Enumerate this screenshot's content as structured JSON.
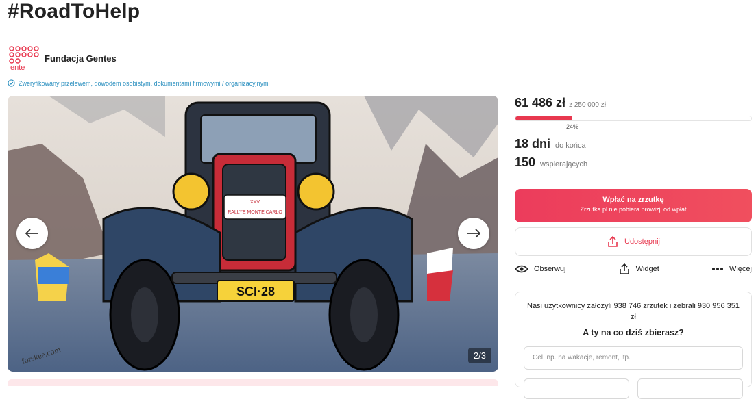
{
  "title": "#RoadToHelp",
  "organizer": {
    "name": "Fundacja Gentes",
    "logo_text": "ente"
  },
  "verification": "Zweryfikowany przelewem, dowodem osobistym, dokumentami firmowymi / organizacyjnymi",
  "gallery": {
    "counter": "2/3",
    "plate_text": "SCI·28",
    "badge_text": "RALLYE MONTE CARLO",
    "badge_top": "XXV",
    "signature": "forskee.com"
  },
  "stats": {
    "raised": "61 486 zł",
    "goal": "z 250 000 zł",
    "progress_percent": 24,
    "progress_label": "24%",
    "days": "18 dni",
    "days_label": "do końca",
    "supporters": "150",
    "supporters_label": "wspierających"
  },
  "donate": {
    "label": "Wpłać na zrzutkę",
    "sublabel": "Zrzutka.pl nie pobiera prowizji od wpłat"
  },
  "share_label": "Udostępnij",
  "actions": {
    "watch": "Obserwuj",
    "widget": "Widget",
    "more": "Więcej"
  },
  "promo": {
    "text": "Nasi użytkownicy założyli 938 746 zrzutek i zebrali 930 956 351 zł",
    "question": "A ty na co dziś zbierasz?",
    "placeholder": "Cel, np. na wakacje, remont, itp."
  },
  "colors": {
    "accent": "#e8384f",
    "verified": "#2a8fbf"
  }
}
